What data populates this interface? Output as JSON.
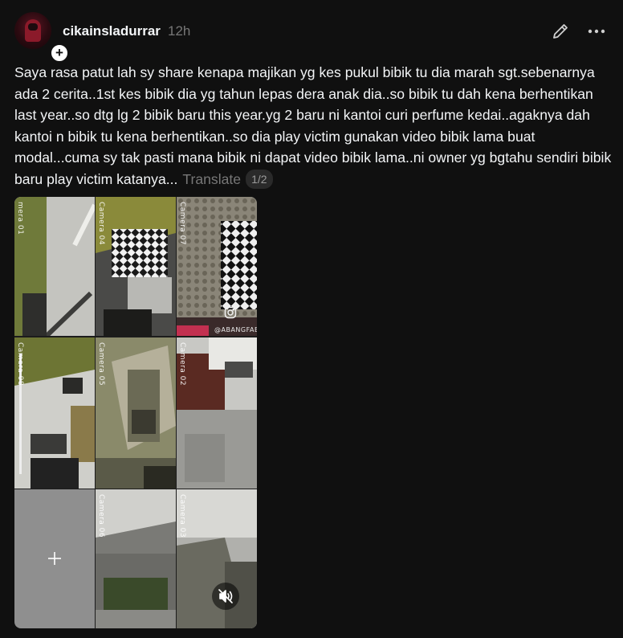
{
  "post": {
    "username": "cikainsladurrar",
    "timestamp": "12h",
    "text": "Saya rasa patut lah sy share kenapa majikan yg kes pukul bibik tu dia marah sgt.sebenarnya ada 2 cerita..1st kes bibik dia yg tahun lepas dera anak dia..so bibik tu dah kena berhentikan last year..so dtg lg 2 bibik baru this year.yg 2 baru ni kantoi curi perfume kedai..agaknya dah kantoi n bibik tu kena berhentikan..so dia play victim gunakan video bibik lama buat modal...cuma sy tak pasti mana bibik ni dapat video bibik lama..ni owner yg bgtahu sendiri bibik baru play victim katanya...",
    "translate_label": "Translate",
    "page_indicator": "1/2"
  },
  "header": {
    "follow_badge": "+",
    "edit_icon": "pencil-icon",
    "more_icon": "more-horizontal-icon"
  },
  "media": {
    "cameras": [
      {
        "label": "mera 01"
      },
      {
        "label": "Camera 04"
      },
      {
        "label": "Camera 07"
      },
      {
        "label": "Camera 08"
      },
      {
        "label": "Camera 05"
      },
      {
        "label": "Camera 02"
      },
      {
        "label": "Camera 06"
      },
      {
        "label": "Camera 03"
      }
    ],
    "watermark": "@ABANGFAB",
    "add_tile_icon": "plus-icon",
    "mute_icon": "speaker-muted-icon",
    "instagram_icon": "instagram-icon"
  },
  "colors": {
    "background": "#101010",
    "text_primary": "#f3f5f7",
    "text_secondary": "#777777",
    "pill_bg": "#2a2a2a"
  }
}
